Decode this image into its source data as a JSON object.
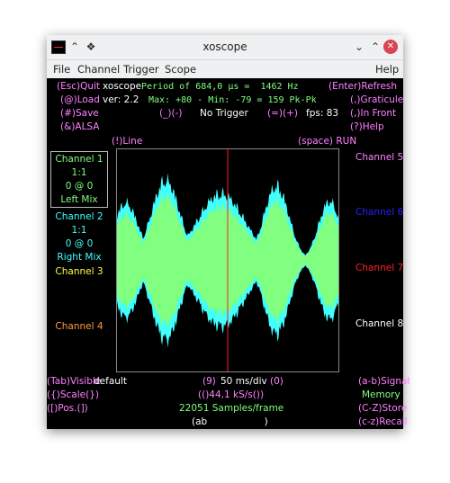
{
  "window": {
    "title": "xoscope"
  },
  "menu": [
    "File",
    "Channel",
    "Trigger",
    "Scope",
    "Help"
  ],
  "top": {
    "quit": "(Esc)Quit",
    "app_name": "xoscope",
    "load": "(@)Load",
    "version": "ver: 2.2",
    "save": "(#)Save",
    "alsa": "(&)ALSA",
    "period": "Period of 684,0 µs =  1462 Hz",
    "maxmin": "Max: +80 - Min: -79 = 159 Pk-Pk",
    "trigger_keys": "(_)(-)",
    "trigger_mode": "No Trigger",
    "trigger_keys2": "(=)(+)",
    "fps": "fps: 83",
    "refresh": "(Enter)Refresh",
    "graticule": "(,)Graticule",
    "infront": "(,)In Front",
    "help": "(?)Help",
    "line": "(!)Line",
    "run": "(space) RUN"
  },
  "channels_left": {
    "ch1": {
      "name": "Channel 1",
      "scale": "1:1",
      "pos": "0 @ 0",
      "source": "Left Mix"
    },
    "ch2": {
      "name": "Channel 2",
      "scale": "1:1",
      "pos": "0 @ 0",
      "source": "Right Mix"
    },
    "ch3": "Channel 3",
    "ch4": "Channel 4"
  },
  "channels_right": {
    "ch5": "Channel 5",
    "ch6": "Channel 6",
    "ch7": "Channel 7",
    "ch8": "Channel 8"
  },
  "bottom": {
    "visible": "(Tab)Visible",
    "visible_val": "default",
    "scale": "({)Scale(})",
    "pos": "([)Pos.(])",
    "timebase_key1": "(9)",
    "timebase": "50 ms/div",
    "timebase_key2": "(0)",
    "rate": "(()44,1 kS/s())",
    "samples": "22051 Samples/frame",
    "math": "(ab                   )",
    "signal": "(a-b)Signal",
    "memory": "Memory",
    "store": "(C-Z)Store",
    "recall": "(c-z)Recall"
  },
  "colors": {
    "background": "#000000",
    "ch1": "#80ff80",
    "ch2": "#40ffff",
    "marker": "#ff2020"
  }
}
